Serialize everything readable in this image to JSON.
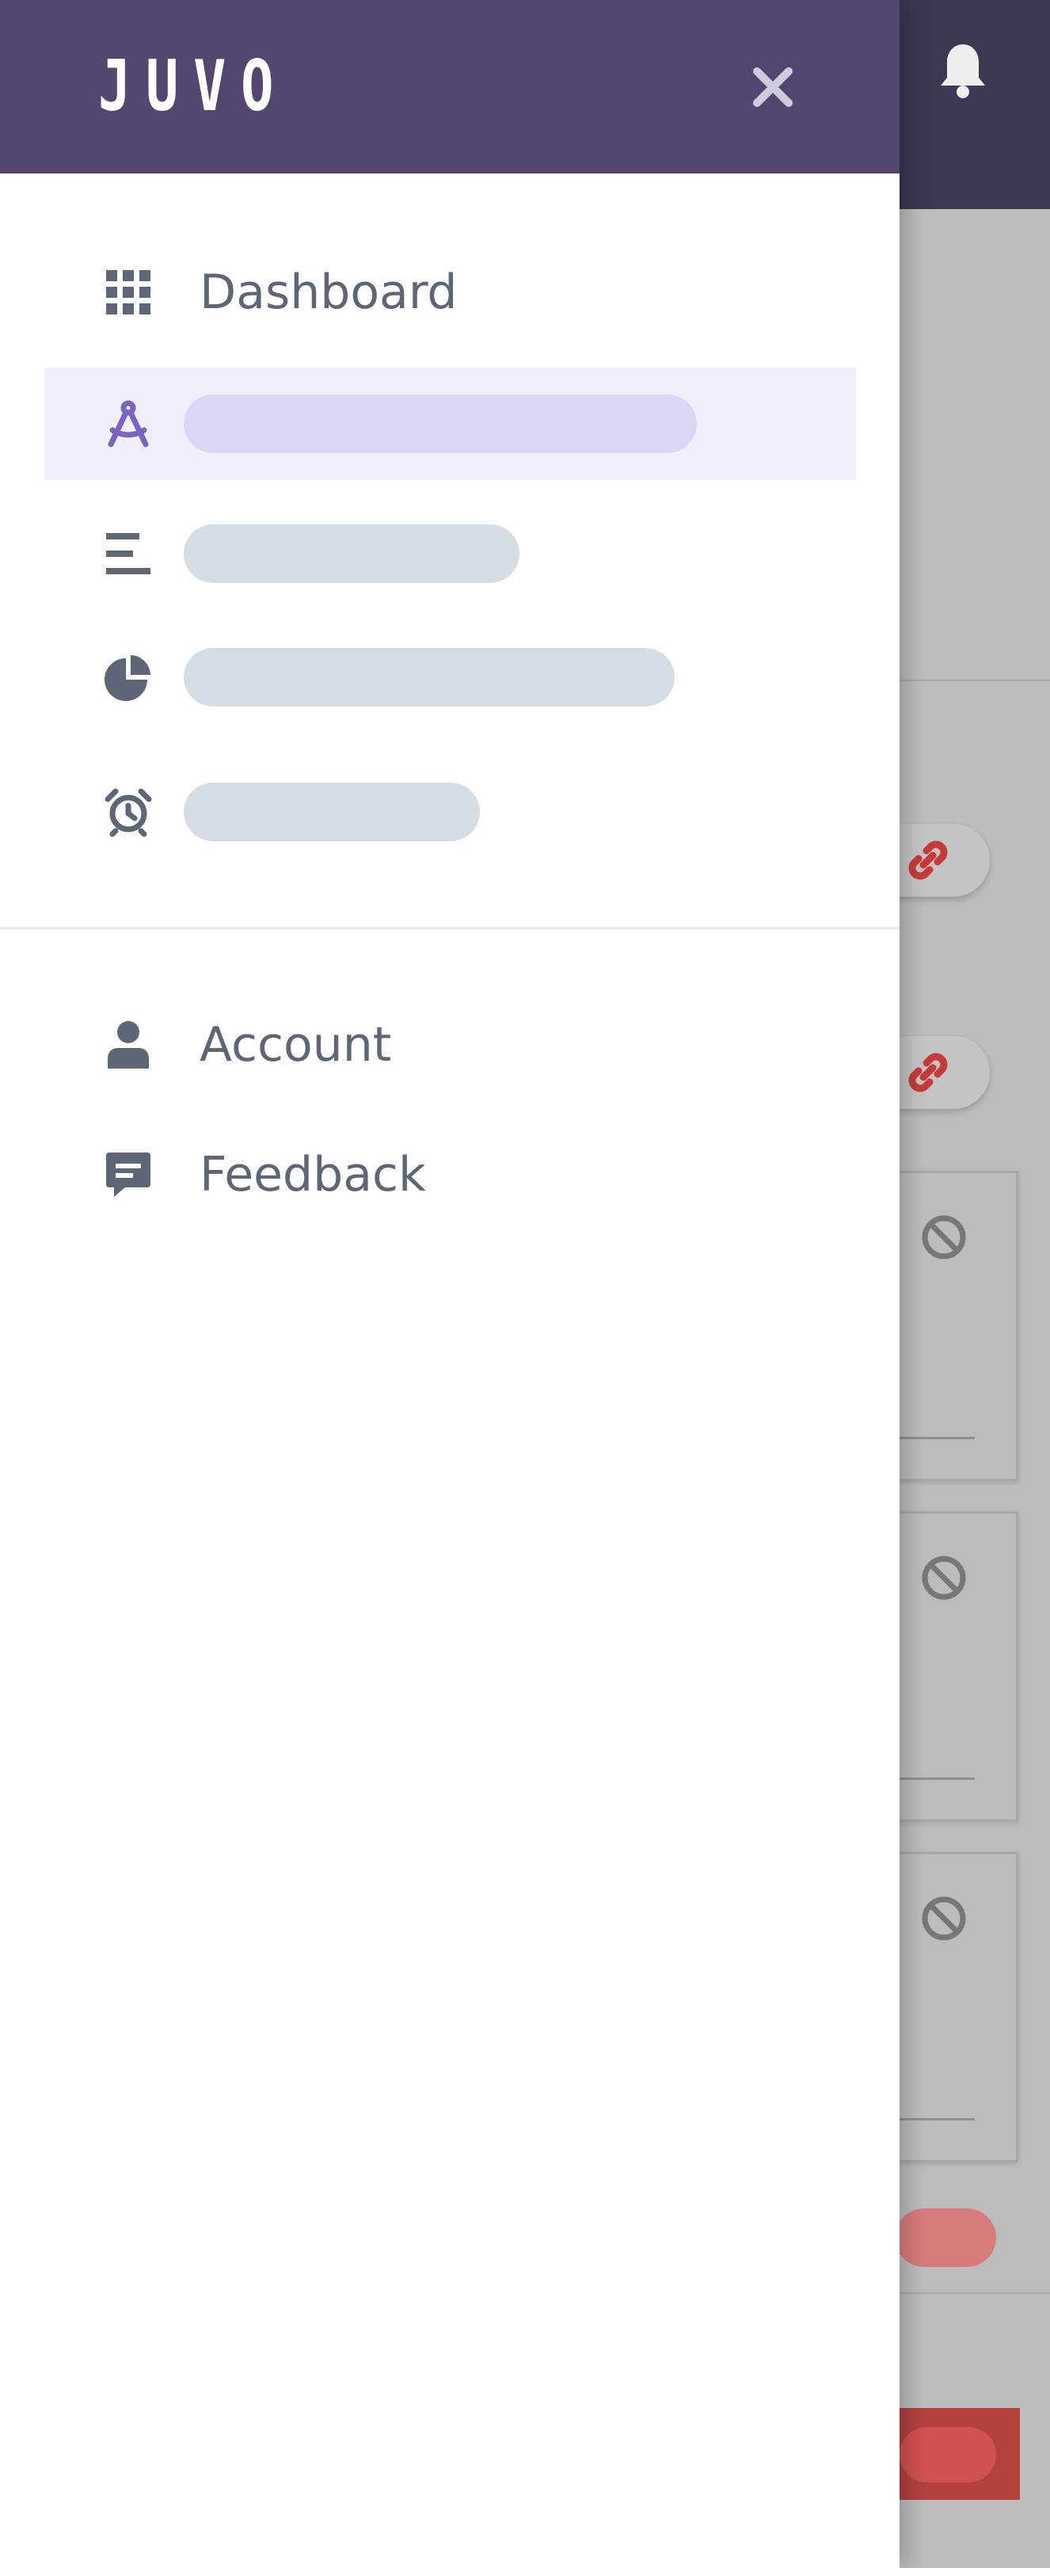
{
  "app": {
    "logo_text": "JUVO"
  },
  "colors": {
    "header": "#534770",
    "active_accent": "#7a64c0",
    "active_bg": "#f0eef8",
    "muted_icon": "#5e6676",
    "danger": "#b44040"
  },
  "drawer": {
    "close_icon": "close-icon",
    "primary_nav": [
      {
        "label": "Dashboard",
        "icon": "grid-icon",
        "active": false
      },
      {
        "label": "",
        "icon": "compass-icon",
        "active": true,
        "loading": true
      },
      {
        "label": "",
        "icon": "list-icon",
        "active": false,
        "loading": true
      },
      {
        "label": "",
        "icon": "pie-chart-icon",
        "active": false,
        "loading": true
      },
      {
        "label": "",
        "icon": "alarm-clock-icon",
        "active": false,
        "loading": true
      }
    ],
    "secondary_nav": [
      {
        "label": "Account",
        "icon": "user-icon"
      },
      {
        "label": "Feedback",
        "icon": "feedback-icon"
      }
    ]
  },
  "background": {
    "notification_icon": "bell-icon",
    "link_icons": [
      "link-icon",
      "link-icon"
    ],
    "disabled_icons": [
      "ban-icon",
      "ban-icon",
      "ban-icon"
    ]
  }
}
